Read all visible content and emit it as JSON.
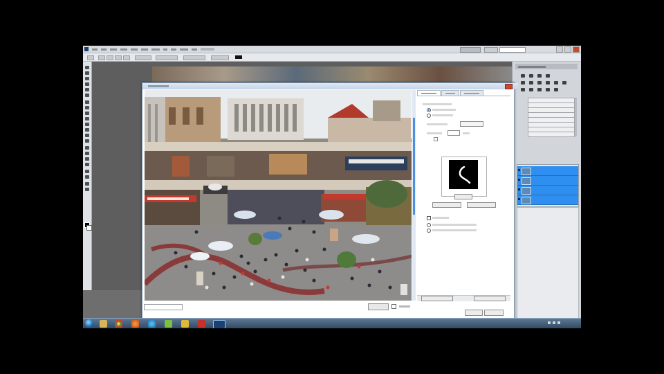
{
  "window": {
    "title": ""
  },
  "menu": {
    "items": [
      "",
      "",
      "",
      "",
      "",
      "",
      "",
      "",
      "",
      "",
      "",
      ""
    ]
  },
  "toolbar": {
    "zoom": ""
  },
  "dialog": {
    "title": "",
    "tabs": [
      "",
      "",
      ""
    ],
    "zoom_value": "",
    "preview_button": "",
    "preview_label": "",
    "ok": "",
    "cancel": ""
  },
  "settings": {
    "section_title": "",
    "radio_1": "",
    "radio_2": "",
    "select_1_label": "",
    "select_1_value": "",
    "field_label": "",
    "field_value": "",
    "tip_label": "",
    "btn_1": "",
    "btn_2": "",
    "checkbox_label": "",
    "option_1": "",
    "option_2": ""
  },
  "right_panel": {
    "title": "",
    "list": [
      "",
      "",
      "",
      "",
      "",
      "",
      "",
      ""
    ]
  },
  "layers": [
    {
      "name": ""
    },
    {
      "name": ""
    },
    {
      "name": ""
    },
    {
      "name": ""
    }
  ],
  "taskbar": {
    "clock_time": "",
    "clock_date": ""
  },
  "colors": {
    "accent_selection": "#2f8ff0",
    "taskbar": "#2f4660",
    "close_button": "#c9482e"
  }
}
